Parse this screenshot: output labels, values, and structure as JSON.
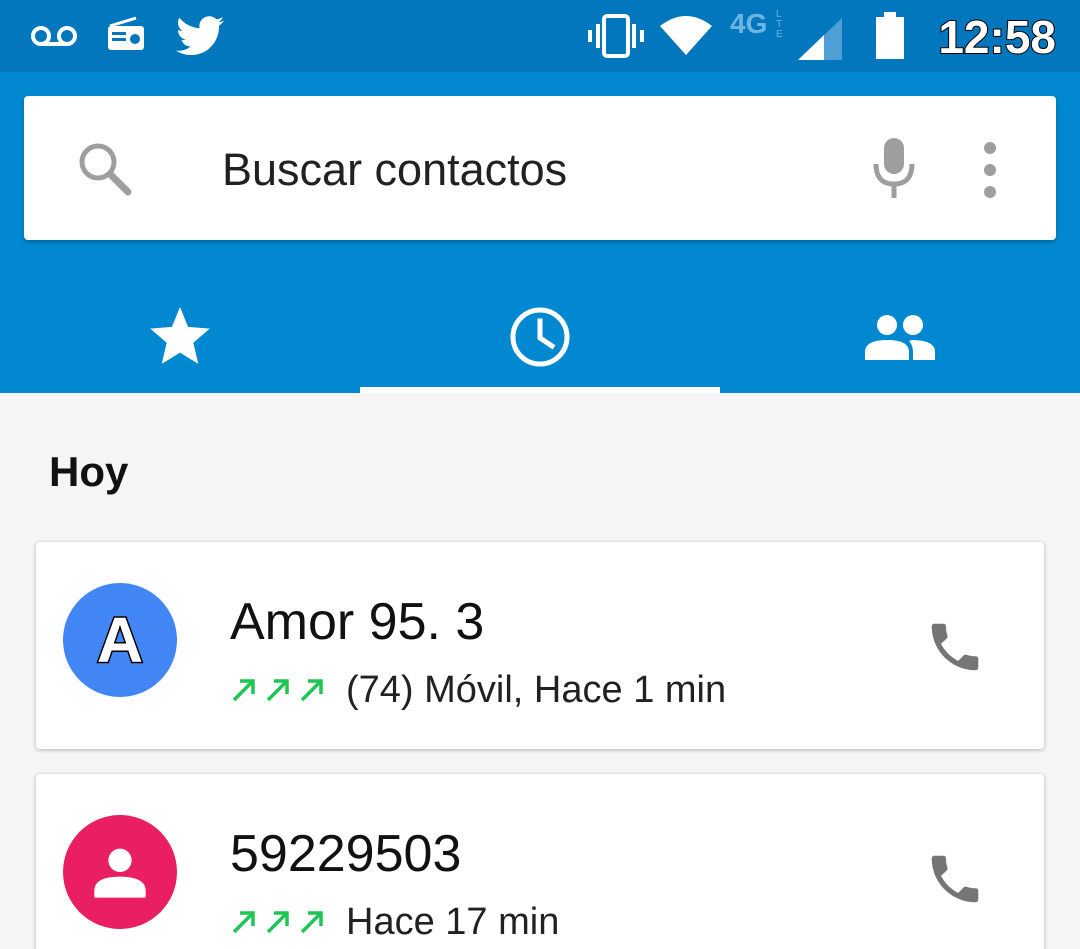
{
  "status_bar": {
    "icons": [
      "voicemail-icon",
      "radio-icon",
      "twitter-icon",
      "vibrate-icon",
      "wifi-icon",
      "4g-lte-icon",
      "signal-icon",
      "battery-icon"
    ],
    "network_label": "4G",
    "time": "12:58"
  },
  "search": {
    "placeholder": "Buscar contactos",
    "icons": [
      "search-icon",
      "mic-icon",
      "more-vert-icon"
    ]
  },
  "tabs": [
    {
      "name": "favorites",
      "icon": "star-icon",
      "selected": false
    },
    {
      "name": "recents",
      "icon": "clock-icon",
      "selected": true
    },
    {
      "name": "contacts",
      "icon": "people-icon",
      "selected": false
    }
  ],
  "section": {
    "title": "Hoy"
  },
  "calls": [
    {
      "avatar_letter": "A",
      "avatar_color": "#4285f4",
      "name": "Amor 95. 3",
      "detail": "(74) Móvil, Hace 1 min",
      "arrows": 3,
      "direction_icon": "outgoing-call-arrow-icon"
    },
    {
      "avatar_letter": "",
      "avatar_color": "#e91e63",
      "avatar_icon": "person-icon",
      "name": "59229503",
      "detail": "Hace 17 min",
      "arrows": 3,
      "direction_icon": "outgoing-call-arrow-icon"
    }
  ],
  "colors": {
    "status_bar": "#0277bd",
    "app_bar": "#0288d1",
    "arrow_green": "#1ec753",
    "icon_gray": "#757575"
  }
}
